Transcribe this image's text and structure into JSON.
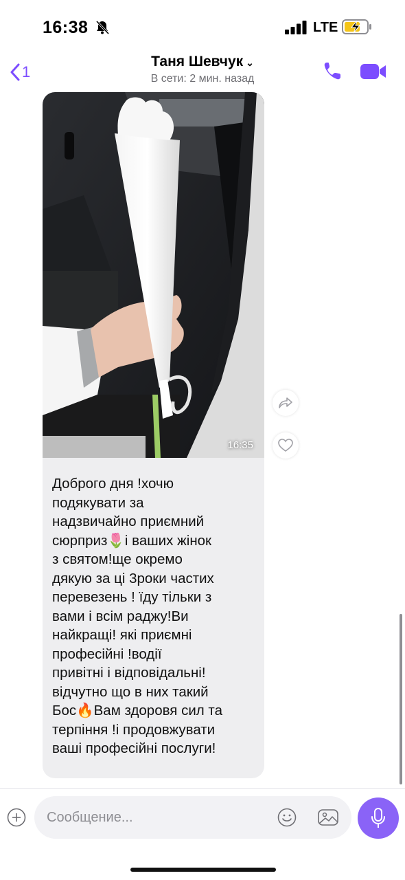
{
  "status_bar": {
    "time": "16:38",
    "network": "LTE"
  },
  "header": {
    "back_count": "1",
    "contact_name": "Таня Шевчук",
    "contact_status": "В сети: 2 мин. назад"
  },
  "message": {
    "photo_time": "16:35",
    "text_lines": [
      "Доброго дня !хочю",
      "подякувати за",
      "надзвичайно приємний",
      "сюрприз🌷і ваших жінок",
      "з святом!ще окремо",
      "дякую за ці 3роки частих",
      "перевезень ! їду тільки з",
      "вами і всім раджу!Ви",
      "найкращі! які приємні",
      "професійні  !водії",
      "привітні і відповідальні!",
      "відчутно що в них такий",
      "Бос🔥Вам здоровя сил та",
      "терпіння !і продовжувати",
      "ваші професійні послуги!"
    ]
  },
  "composer": {
    "placeholder": "Сообщение..."
  },
  "colors": {
    "accent": "#7c4dff",
    "bubble": "#eeeef0",
    "mic_button": "#8a63f7"
  }
}
